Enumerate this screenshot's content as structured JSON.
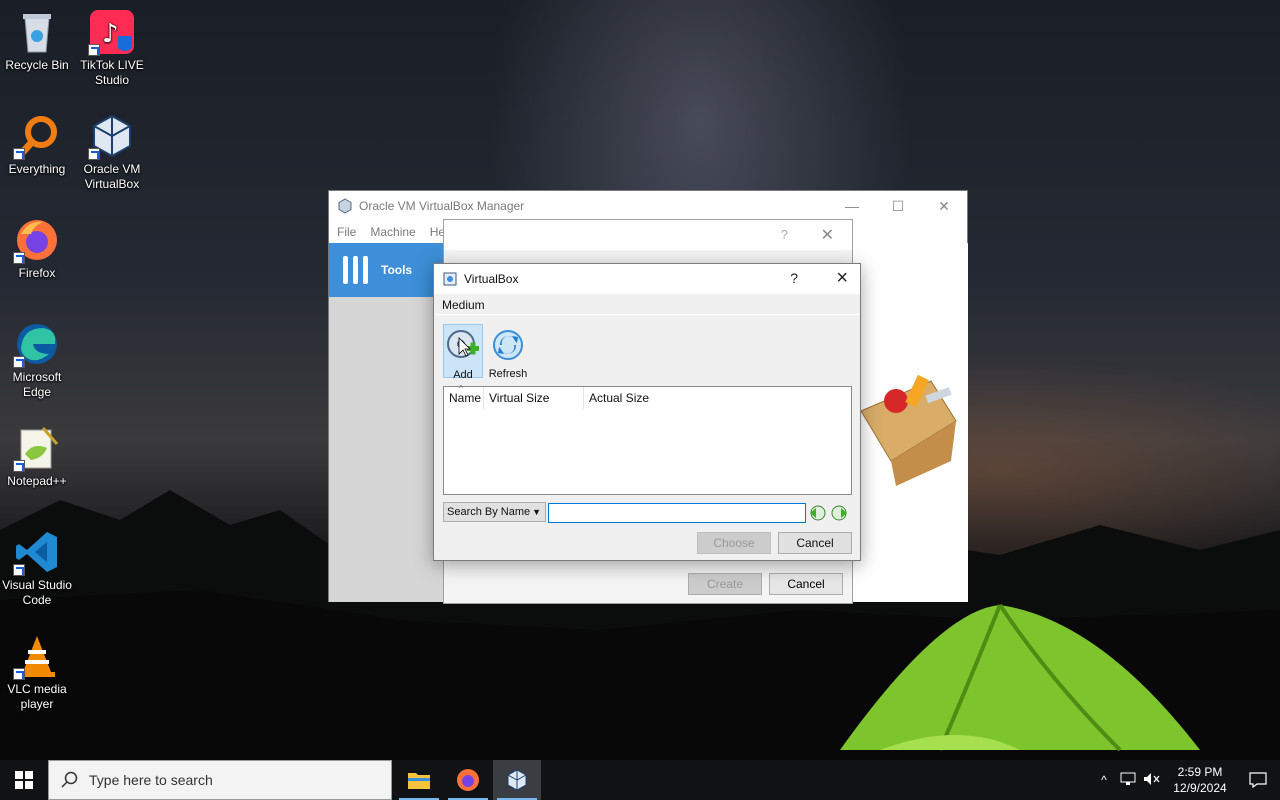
{
  "desktop": {
    "icons": [
      {
        "label": "Recycle Bin",
        "icon": "recycle-bin-icon"
      },
      {
        "label": "TikTok LIVE Studio",
        "icon": "tiktok-icon"
      },
      {
        "label": "Everything",
        "icon": "everything-search-icon"
      },
      {
        "label": "Oracle VM VirtualBox",
        "icon": "virtualbox-icon"
      },
      {
        "label": "Firefox",
        "icon": "firefox-icon"
      },
      {
        "label": "Microsoft Edge",
        "icon": "edge-icon"
      },
      {
        "label": "Notepad++",
        "icon": "notepadpp-icon"
      },
      {
        "label": "Visual Studio Code",
        "icon": "vscode-icon"
      },
      {
        "label": "VLC media player",
        "icon": "vlc-icon"
      }
    ]
  },
  "manager": {
    "title": "Oracle VM VirtualBox Manager",
    "menu": [
      "File",
      "Machine",
      "He"
    ],
    "sidebar_tools": "Tools"
  },
  "middle_dialog": {
    "create_label": "Create",
    "cancel_label": "Cancel"
  },
  "dialog": {
    "title": "VirtualBox",
    "help": "?",
    "section_label": "Medium",
    "toolbar": {
      "add_label": "Add",
      "refresh_label": "Refresh"
    },
    "table": {
      "columns": [
        "Name",
        "Virtual Size",
        "Actual Size"
      ],
      "rows": []
    },
    "search": {
      "type_selected": "Search By Name",
      "value": ""
    },
    "choose_label": "Choose",
    "cancel_label": "Cancel"
  },
  "taskbar": {
    "search_placeholder": "Type here to search",
    "time": "2:59 PM",
    "date": "12/9/2024"
  },
  "colors": {
    "accent": "#3c8fd8",
    "taskbar": "#101214",
    "active_focus": "#0078d7"
  }
}
